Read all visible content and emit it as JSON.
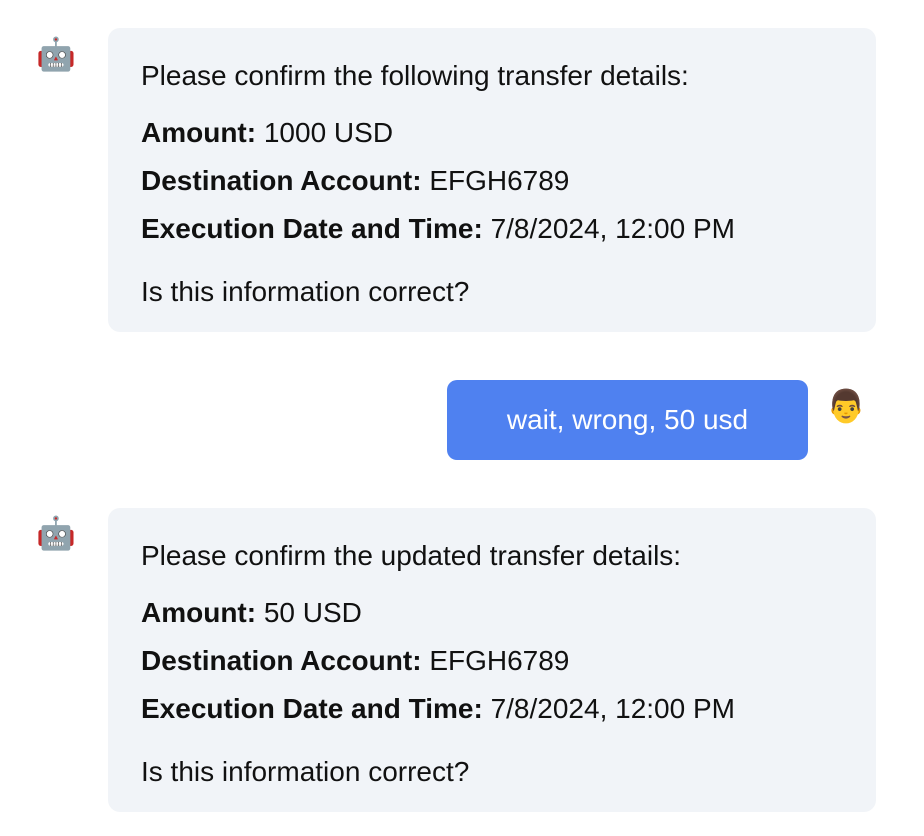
{
  "messages": [
    {
      "role": "assistant",
      "avatar": "🤖",
      "intro": "Please confirm the following transfer details:",
      "fields": [
        {
          "label": "Amount:",
          "value": "1000 USD"
        },
        {
          "label": "Destination Account:",
          "value": "EFGH6789"
        },
        {
          "label": "Execution Date and Time:",
          "value": "7/8/2024, 12:00 PM"
        }
      ],
      "question": "Is this information correct?"
    },
    {
      "role": "user",
      "avatar": "👨",
      "text": "wait, wrong, 50 usd"
    },
    {
      "role": "assistant",
      "avatar": "🤖",
      "intro": "Please confirm the updated transfer details:",
      "fields": [
        {
          "label": "Amount:",
          "value": "50 USD"
        },
        {
          "label": "Destination Account:",
          "value": "EFGH6789"
        },
        {
          "label": "Execution Date and Time:",
          "value": "7/8/2024, 12:00 PM"
        }
      ],
      "question": "Is this information correct?"
    }
  ],
  "colors": {
    "bot_bubble_bg": "#f1f4f8",
    "user_bubble_bg": "#4f81f0",
    "user_text": "#ffffff"
  }
}
